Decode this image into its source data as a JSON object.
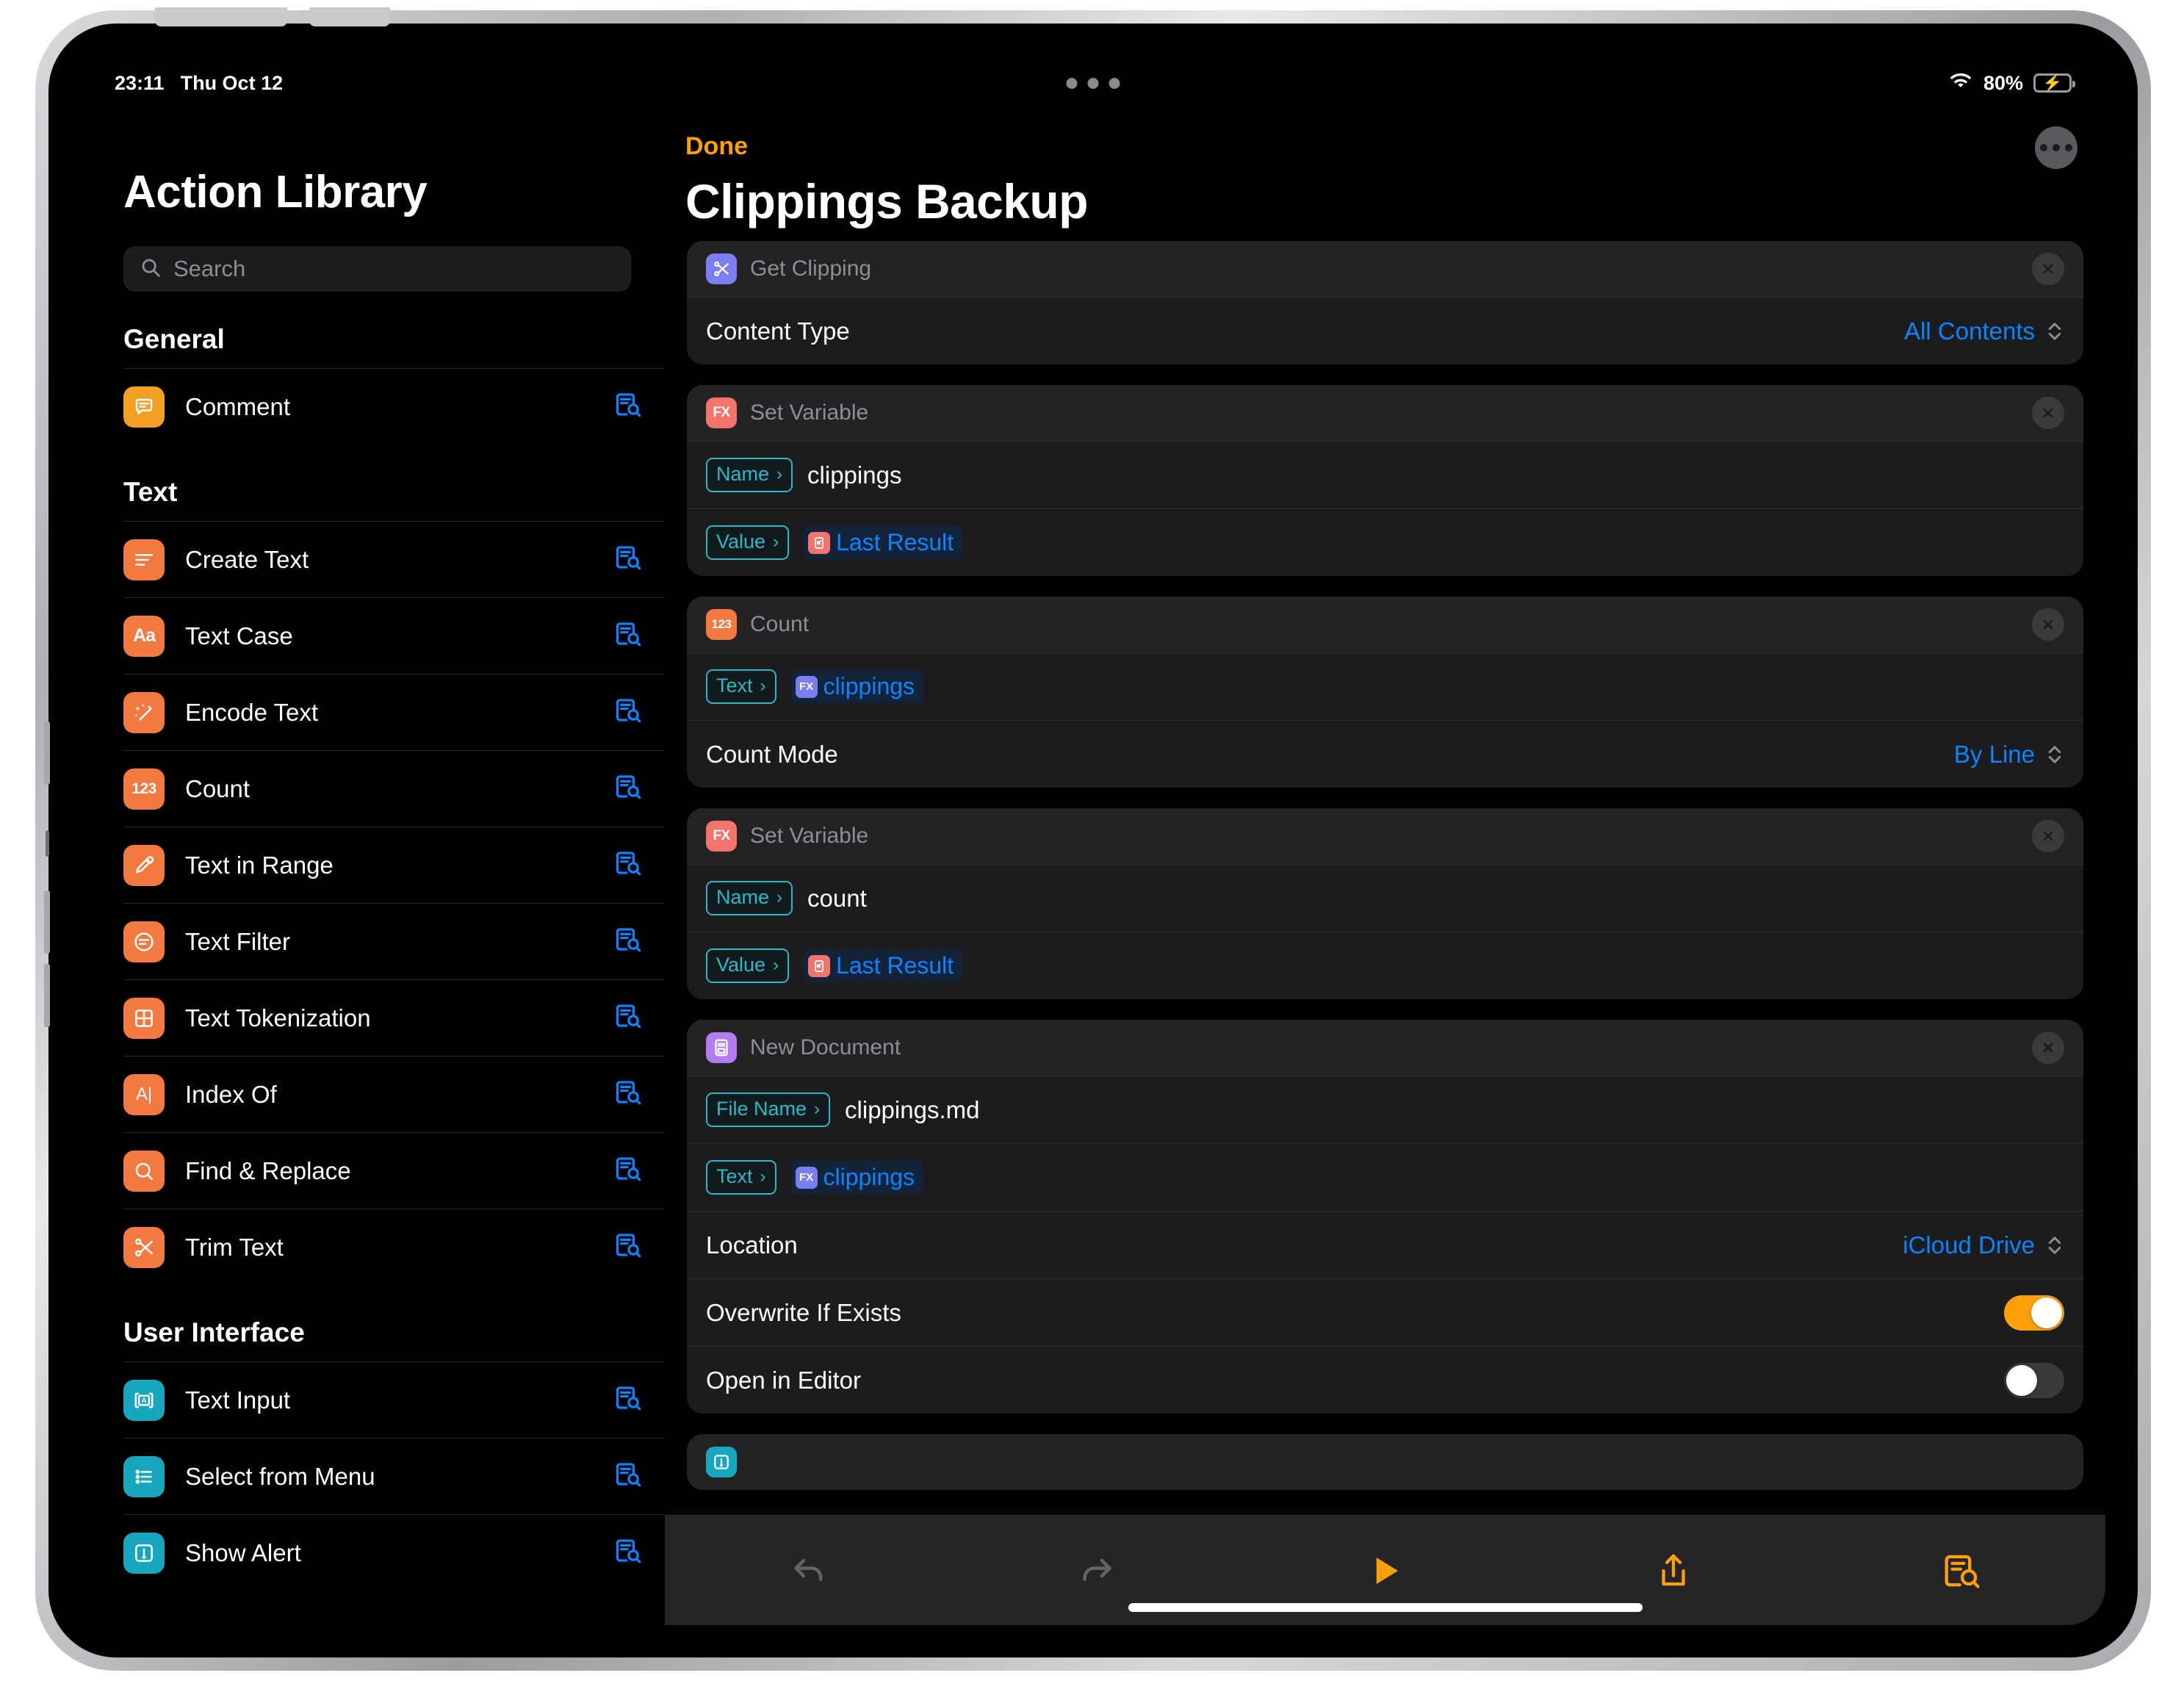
{
  "status_bar": {
    "time": "23:11",
    "date": "Thu Oct 12",
    "battery_percent": "80%",
    "wifi_icon": "wifi-icon",
    "battery_icon": "battery-charging-icon"
  },
  "sidebar": {
    "title": "Action Library",
    "search": {
      "placeholder": "Search",
      "value": "",
      "icon": "search-icon"
    },
    "sections": [
      {
        "header": "General",
        "items": [
          {
            "label": "Comment",
            "icon": "comment-bubble-icon",
            "glyph": "💬",
            "color": "#f2a024",
            "info_icon": "doc-search-icon"
          }
        ]
      },
      {
        "header": "Text",
        "items": [
          {
            "label": "Create Text",
            "icon": "text-lines-icon",
            "glyph": "lines",
            "color": "#f2793f",
            "info_icon": "doc-search-icon"
          },
          {
            "label": "Text Case",
            "icon": "text-case-icon",
            "glyph": "Aa",
            "color": "#f2793f",
            "info_icon": "doc-search-icon"
          },
          {
            "label": "Encode Text",
            "icon": "magic-wand-icon",
            "glyph": "wand",
            "color": "#f2793f",
            "info_icon": "doc-search-icon"
          },
          {
            "label": "Count",
            "icon": "numbers-123-icon",
            "glyph": "123",
            "color": "#f2793f",
            "info_icon": "doc-search-icon"
          },
          {
            "label": "Text in Range",
            "icon": "eyedropper-icon",
            "glyph": "dropper",
            "color": "#f2793f",
            "info_icon": "doc-search-icon"
          },
          {
            "label": "Text Filter",
            "icon": "filter-circle-icon",
            "glyph": "filter",
            "color": "#f2793f",
            "info_icon": "doc-search-icon"
          },
          {
            "label": "Text Tokenization",
            "icon": "grid-table-icon",
            "glyph": "grid",
            "color": "#f2793f",
            "info_icon": "doc-search-icon"
          },
          {
            "label": "Index Of",
            "icon": "a-cursor-icon",
            "glyph": "A|",
            "color": "#f2793f",
            "info_icon": "doc-search-icon"
          },
          {
            "label": "Find & Replace",
            "icon": "magnifier-icon",
            "glyph": "search",
            "color": "#f2793f",
            "info_icon": "doc-search-icon"
          },
          {
            "label": "Trim Text",
            "icon": "scissors-icon",
            "glyph": "scissors",
            "color": "#f2793f",
            "info_icon": "doc-search-icon"
          }
        ]
      },
      {
        "header": "User Interface",
        "items": [
          {
            "label": "Text Input",
            "icon": "text-input-icon",
            "glyph": "A-box",
            "color": "#16a6bd",
            "info_icon": "doc-search-icon"
          },
          {
            "label": "Select from Menu",
            "icon": "bullet-list-icon",
            "glyph": "list",
            "color": "#16a6bd",
            "info_icon": "doc-search-icon"
          },
          {
            "label": "Show Alert",
            "icon": "alert-icon",
            "glyph": "alert",
            "color": "#16a6bd",
            "info_icon": "doc-search-icon"
          }
        ]
      }
    ]
  },
  "main": {
    "done_label": "Done",
    "more_icon": "ellipsis-circle-icon",
    "title": "Clippings Backup",
    "cards": [
      {
        "name": "Get Clipping",
        "icon": "scissors-icon",
        "icon_color": "#7b7ef0",
        "icon_glyph": "scissors",
        "close_icon": "close-circle-icon",
        "rows": [
          {
            "type": "picker",
            "label": "Content Type",
            "value": "All Contents",
            "control_icon": "stepper-chevrons-icon"
          }
        ]
      },
      {
        "name": "Set Variable",
        "icon": "fx-icon",
        "icon_color": "#f4736d",
        "icon_glyph": "FX",
        "close_icon": "close-circle-icon",
        "rows": [
          {
            "type": "param_text",
            "pill": "Name",
            "value": "clippings"
          },
          {
            "type": "param_var",
            "pill": "Value",
            "chip_label": "Last Result",
            "chip_icon": "last-result-icon",
            "chip_color": "#f4736d"
          }
        ]
      },
      {
        "name": "Count",
        "icon": "numbers-123-icon",
        "icon_color": "#f2793f",
        "icon_glyph": "123",
        "close_icon": "close-circle-icon",
        "rows": [
          {
            "type": "param_var",
            "pill": "Text",
            "chip_label": "clippings",
            "chip_icon": "fx-icon",
            "chip_color": "#7b7ef0"
          },
          {
            "type": "picker",
            "label": "Count Mode",
            "value": "By Line",
            "control_icon": "stepper-chevrons-icon"
          }
        ]
      },
      {
        "name": "Set Variable",
        "icon": "fx-icon",
        "icon_color": "#f4736d",
        "icon_glyph": "FX",
        "close_icon": "close-circle-icon",
        "rows": [
          {
            "type": "param_text",
            "pill": "Name",
            "value": "count"
          },
          {
            "type": "param_var",
            "pill": "Value",
            "chip_label": "Last Result",
            "chip_icon": "last-result-icon",
            "chip_color": "#f4736d"
          }
        ]
      },
      {
        "name": "New Document",
        "icon": "document-icon",
        "icon_color": "#b57bf0",
        "icon_glyph": "doc",
        "close_icon": "close-circle-icon",
        "rows": [
          {
            "type": "param_text",
            "pill": "File Name",
            "value": "clippings.md"
          },
          {
            "type": "param_var",
            "pill": "Text",
            "chip_label": "clippings",
            "chip_icon": "fx-icon",
            "chip_color": "#7b7ef0"
          },
          {
            "type": "picker",
            "label": "Location",
            "value": "iCloud Drive",
            "control_icon": "stepper-chevrons-icon"
          },
          {
            "type": "toggle",
            "label": "Overwrite If Exists",
            "state": "on"
          },
          {
            "type": "toggle",
            "label": "Open in Editor",
            "state": "off"
          }
        ]
      }
    ]
  },
  "toolbar": {
    "buttons": [
      {
        "name": "undo-button",
        "icon": "undo-arrow-icon",
        "enabled": false
      },
      {
        "name": "redo-button",
        "icon": "redo-arrow-icon",
        "enabled": false
      },
      {
        "name": "run-button",
        "icon": "play-icon",
        "enabled": true
      },
      {
        "name": "share-button",
        "icon": "share-icon",
        "enabled": true
      },
      {
        "name": "library-button",
        "icon": "doc-search-icon",
        "enabled": true
      }
    ]
  },
  "colors": {
    "accent_orange": "#ff9f0a",
    "accent_blue": "#0a84ff",
    "pill_teal": "#2eb8c6",
    "toggle_on": "#ff9f0a",
    "card_bg": "#1c1c1e"
  }
}
